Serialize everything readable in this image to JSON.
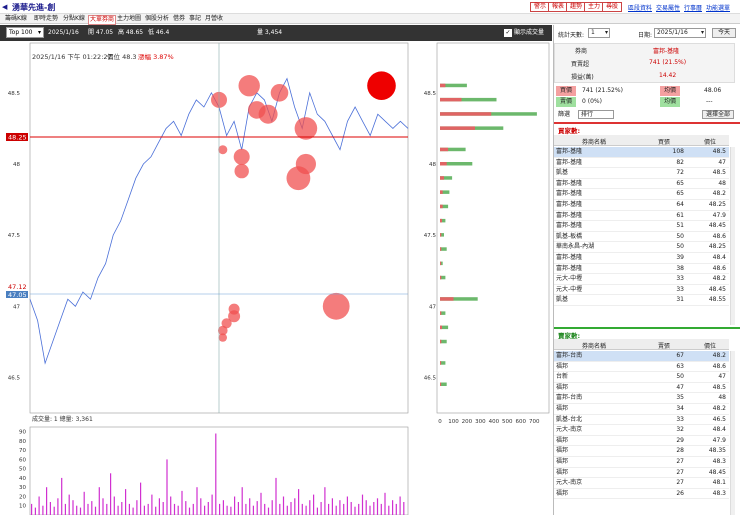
{
  "app": {
    "title": "湧華先進-創"
  },
  "toolbar_buttons": [
    "警示",
    "報表",
    "趨勢",
    "主力",
    "尋股"
  ],
  "toolbar_links": [
    "區段資料",
    "交易屬性",
    "行事曆",
    "功能選單"
  ],
  "tabs": [
    "籌碼K線",
    "即時走勢",
    "分點K線",
    "大單券商",
    "主力地圖",
    "個股分析",
    "借券",
    "事記",
    "月營收"
  ],
  "active_tab": 3,
  "infobar": {
    "top_select": "Top 100",
    "date": "2025/1/16",
    "open": "開 47.05",
    "high": "高 48.65",
    "low": "低 46.4",
    "volume": "量 3,454",
    "show_volume": "顯示成交量",
    "checkbox": "✓"
  },
  "chart": {
    "tooltip_time": "2025/1/16 下午 01:22:27",
    "tooltip_price": "價位 48.3",
    "tooltip_change": "漲幅 3.87%",
    "current_price": "48.25",
    "ref_price": "47.12",
    "open_price": "47.05",
    "volume_title": "成交量: 1   總量: 3,361",
    "accent": "#dd0000"
  },
  "chart_data": [
    {
      "type": "line",
      "name": "intraday price",
      "ylim": [
        46.25,
        48.85
      ],
      "y_ticks": [
        "48.5",
        "48",
        "47.5",
        "47",
        "46.5"
      ],
      "x": [
        0,
        2,
        4,
        6,
        8,
        10,
        12,
        14,
        16,
        18,
        20,
        22,
        24,
        26,
        28,
        30,
        32,
        34,
        36,
        38,
        40,
        42,
        44,
        46,
        48,
        50,
        52,
        54,
        56,
        58,
        60,
        62,
        64,
        66,
        68,
        70,
        72,
        74,
        76,
        78,
        80,
        82,
        84,
        86,
        88,
        90,
        92,
        94,
        96,
        98,
        100
      ],
      "y": [
        47.05,
        46.9,
        46.6,
        46.75,
        46.9,
        47.05,
        47.0,
        47.1,
        47.05,
        47.2,
        47.3,
        47.5,
        47.6,
        47.75,
        47.9,
        48.0,
        48.05,
        48.15,
        48.25,
        48.3,
        48.2,
        48.35,
        48.45,
        48.4,
        48.5,
        48.4,
        48.2,
        48.3,
        48.1,
        48.4,
        48.5,
        48.45,
        48.3,
        48.5,
        48.6,
        48.4,
        48.25,
        48.5,
        48.35,
        48.3,
        48.2,
        48.1,
        48.3,
        48.4,
        48.3,
        48.2,
        48.35,
        48.3,
        48.25,
        48.3,
        48.25
      ]
    },
    {
      "type": "scatter",
      "name": "large orders",
      "points": [
        {
          "t": 93,
          "price": 48.55,
          "volume": 80
        },
        {
          "t": 58,
          "price": 48.55,
          "volume": 45
        },
        {
          "t": 66,
          "price": 48.5,
          "volume": 30
        },
        {
          "t": 50,
          "price": 48.45,
          "volume": 25
        },
        {
          "t": 63,
          "price": 48.35,
          "volume": 35
        },
        {
          "t": 60,
          "price": 48.38,
          "volume": 30
        },
        {
          "t": 73,
          "price": 48.25,
          "volume": 50
        },
        {
          "t": 73,
          "price": 48.0,
          "volume": 40
        },
        {
          "t": 71,
          "price": 47.9,
          "volume": 55
        },
        {
          "t": 56,
          "price": 48.05,
          "volume": 25
        },
        {
          "t": 56,
          "price": 47.95,
          "volume": 20
        },
        {
          "t": 51,
          "price": 48.1,
          "volume": 8
        },
        {
          "t": 81,
          "price": 47.0,
          "volume": 70
        },
        {
          "t": 54,
          "price": 46.98,
          "volume": 12
        },
        {
          "t": 54,
          "price": 46.93,
          "volume": 14
        },
        {
          "t": 52,
          "price": 46.88,
          "volume": 10
        },
        {
          "t": 51,
          "price": 46.83,
          "volume": 9
        },
        {
          "t": 51,
          "price": 46.78,
          "volume": 7
        }
      ]
    },
    {
      "type": "bar",
      "name": "volume by price",
      "x_ticks": [
        "0",
        "100",
        "200",
        "300",
        "400",
        "500",
        "600",
        "700"
      ],
      "xlim": [
        0,
        780
      ],
      "bars": [
        {
          "price": 48.55,
          "buy": 40,
          "sell": 200
        },
        {
          "price": 48.45,
          "buy": 160,
          "sell": 420
        },
        {
          "price": 48.35,
          "buy": 380,
          "sell": 720
        },
        {
          "price": 48.25,
          "buy": 260,
          "sell": 470
        },
        {
          "price": 48.1,
          "buy": 60,
          "sell": 190
        },
        {
          "price": 48.0,
          "buy": 50,
          "sell": 240
        },
        {
          "price": 47.9,
          "buy": 30,
          "sell": 90
        },
        {
          "price": 47.8,
          "buy": 20,
          "sell": 70
        },
        {
          "price": 47.7,
          "buy": 20,
          "sell": 60
        },
        {
          "price": 47.6,
          "buy": 15,
          "sell": 40
        },
        {
          "price": 47.5,
          "buy": 10,
          "sell": 30
        },
        {
          "price": 47.4,
          "buy": 10,
          "sell": 50
        },
        {
          "price": 47.3,
          "buy": 8,
          "sell": 20
        },
        {
          "price": 47.2,
          "buy": 10,
          "sell": 40
        },
        {
          "price": 47.05,
          "buy": 100,
          "sell": 280
        },
        {
          "price": 46.95,
          "buy": 10,
          "sell": 40
        },
        {
          "price": 46.85,
          "buy": 15,
          "sell": 60
        },
        {
          "price": 46.75,
          "buy": 10,
          "sell": 50
        },
        {
          "price": 46.6,
          "buy": 8,
          "sell": 40
        },
        {
          "price": 46.45,
          "buy": 8,
          "sell": 50
        }
      ]
    },
    {
      "type": "bar",
      "name": "volume",
      "y_ticks": [
        "90",
        "80",
        "70",
        "60",
        "50",
        "40",
        "30",
        "20",
        "10"
      ],
      "ylim": [
        0,
        95
      ],
      "values": [
        12,
        8,
        20,
        10,
        30,
        14,
        9,
        18,
        40,
        12,
        22,
        16,
        10,
        8,
        25,
        12,
        15,
        9,
        30,
        18,
        12,
        45,
        20,
        10,
        14,
        28,
        12,
        8,
        16,
        35,
        10,
        12,
        22,
        9,
        18,
        14,
        60,
        20,
        12,
        10,
        26,
        15,
        8,
        12,
        30,
        18,
        10,
        14,
        22,
        88,
        12,
        16,
        10,
        9,
        20,
        14,
        30,
        12,
        18,
        10,
        15,
        24,
        12,
        8,
        16,
        40,
        12,
        20,
        10,
        14,
        18,
        28,
        12,
        10,
        16,
        22,
        8,
        14,
        30,
        12,
        18,
        10,
        16,
        12,
        20,
        14,
        9,
        12,
        22,
        16,
        10,
        14,
        18,
        12,
        24,
        10,
        16,
        12,
        20,
        14
      ]
    }
  ],
  "right_panel": {
    "stat_label": "統計天數:",
    "stat_value": "1",
    "date_label": "日期:",
    "date_value": "2025/1/16",
    "today_button": "今天",
    "broker_hdr": "券商",
    "broker_name": "富邦-基隆",
    "buy_hdr": "買賣超",
    "buy_value": "741 (21.5%)",
    "pnl_hdr": "損益(萬)",
    "pnl_value": "14.42",
    "buy_lbl": "買價",
    "buy_qty": "741 (21.52%)",
    "avg_buy_lbl": "均價",
    "avg_buy": "48.06",
    "sell_lbl": "賣價",
    "sell_qty": "0 (0%)",
    "avg_sell_lbl": "均價",
    "avg_sell": "---",
    "filter_lbl": "篩選",
    "filter_value": "排行",
    "select_all": "選擇全部",
    "buy_section": "買家數:",
    "sell_section": "賣家數:",
    "col_name": "券商名稱",
    "col_vol": "買張",
    "col_vol_sell": "賣張",
    "col_price": "價位",
    "buy_rows": [
      {
        "name": "富邦-基隆",
        "vol": "108",
        "price": "48.5"
      },
      {
        "name": "富邦-基隆",
        "vol": "82",
        "price": "47"
      },
      {
        "name": "凱基",
        "vol": "72",
        "price": "48.5"
      },
      {
        "name": "富邦-基隆",
        "vol": "65",
        "price": "48"
      },
      {
        "name": "富邦-基隆",
        "vol": "65",
        "price": "48.2"
      },
      {
        "name": "富邦-基隆",
        "vol": "64",
        "price": "48.25"
      },
      {
        "name": "富邦-基隆",
        "vol": "61",
        "price": "47.9"
      },
      {
        "name": "富邦-基隆",
        "vol": "51",
        "price": "48.45"
      },
      {
        "name": "凱基-板橋",
        "vol": "50",
        "price": "48.6"
      },
      {
        "name": "華南永昌-內湖",
        "vol": "50",
        "price": "48.25"
      },
      {
        "name": "富邦-基隆",
        "vol": "39",
        "price": "48.4"
      },
      {
        "name": "富邦-基隆",
        "vol": "38",
        "price": "48.6"
      },
      {
        "name": "元大-中壢",
        "vol": "33",
        "price": "48.2"
      },
      {
        "name": "元大-中壢",
        "vol": "33",
        "price": "48.45"
      },
      {
        "name": "凱基",
        "vol": "31",
        "price": "48.55"
      }
    ],
    "sell_rows": [
      {
        "name": "富邦-台南",
        "vol": "67",
        "price": "48.2"
      },
      {
        "name": "福邦",
        "vol": "63",
        "price": "48.6"
      },
      {
        "name": "台新",
        "vol": "50",
        "price": "47"
      },
      {
        "name": "福邦",
        "vol": "47",
        "price": "48.5"
      },
      {
        "name": "富邦-台南",
        "vol": "35",
        "price": "48"
      },
      {
        "name": "福邦",
        "vol": "34",
        "price": "48.2"
      },
      {
        "name": "凱基-台北",
        "vol": "33",
        "price": "46.5"
      },
      {
        "name": "元大-南京",
        "vol": "32",
        "price": "48.4"
      },
      {
        "name": "福邦",
        "vol": "29",
        "price": "47.9"
      },
      {
        "name": "福邦",
        "vol": "28",
        "price": "48.35"
      },
      {
        "name": "福邦",
        "vol": "27",
        "price": "48.3"
      },
      {
        "name": "福邦",
        "vol": "27",
        "price": "48.45"
      },
      {
        "name": "元大-南京",
        "vol": "27",
        "price": "48.1"
      },
      {
        "name": "福邦",
        "vol": "26",
        "price": "48.3"
      }
    ]
  }
}
